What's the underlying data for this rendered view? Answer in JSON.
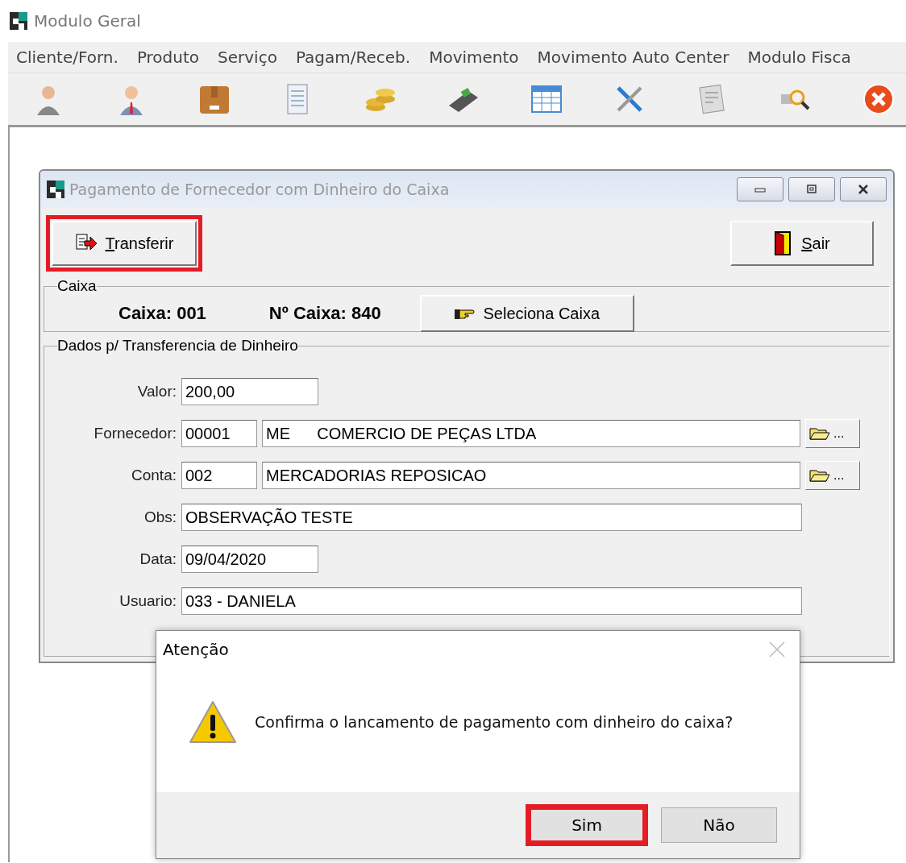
{
  "app": {
    "title": "Modulo Geral"
  },
  "menu": [
    "Cliente/Forn.",
    "Produto",
    "Serviço",
    "Pagam/Receb.",
    "Movimento",
    "Movimento Auto Center",
    "Modulo Fisca"
  ],
  "form": {
    "title": "Pagamento de Fornecedor com Dinheiro do Caixa",
    "buttons": [
      {
        "label": "Transferir",
        "kind": "transfer",
        "highlighted": true
      },
      {
        "label": "Sair",
        "kind": "exit",
        "highlighted": false
      }
    ],
    "caixa": {
      "title": "Caixa",
      "caixa": "Caixa: 001",
      "numero": "Nº Caixa: 840",
      "select_button": "Seleciona Caixa"
    },
    "dados": {
      "title": "Dados p/ Transferencia de Dinheiro",
      "fields": [
        {
          "kind": "short",
          "label": "Valor:",
          "value": "200,00"
        },
        {
          "kind": "lookup",
          "label": "Fornecedor:",
          "code": "00001",
          "name": "ME      COMERCIO DE PEÇAS LTDA",
          "browse": "..."
        },
        {
          "kind": "lookup",
          "label": "Conta:",
          "code": "002",
          "name": "MERCADORIAS REPOSICAO",
          "browse": "..."
        },
        {
          "kind": "wide",
          "label": "Obs:",
          "value": "OBSERVAÇÃO TESTE"
        },
        {
          "kind": "short",
          "label": "Data:",
          "value": "09/04/2020"
        },
        {
          "kind": "wide",
          "label": "Usuario:",
          "value": "033 - DANIELA"
        }
      ]
    }
  },
  "dialog": {
    "title": "Atenção",
    "message": "Confirma o lancamento de pagamento com dinheiro do caixa?",
    "buttons": [
      {
        "label": "Sim",
        "highlighted": true
      },
      {
        "label": "Não",
        "highlighted": false
      }
    ]
  }
}
